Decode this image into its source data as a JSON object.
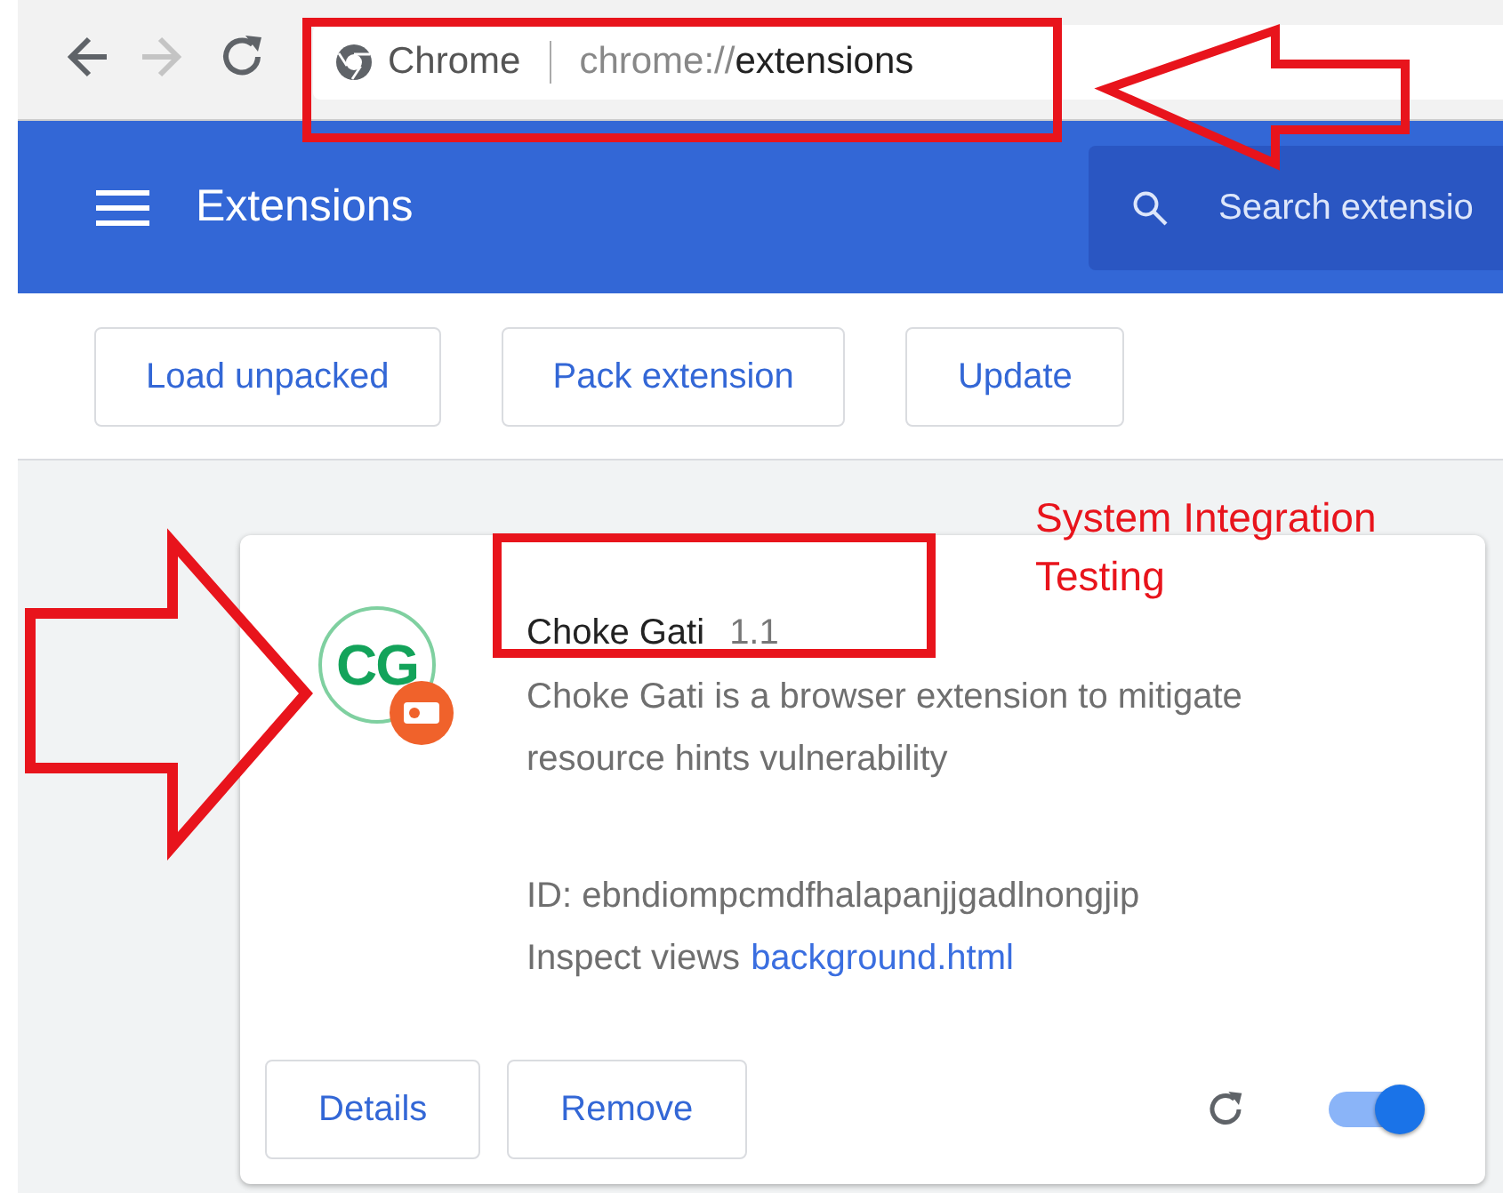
{
  "browser": {
    "nav": [
      {
        "kind": "back",
        "disabled": false
      },
      {
        "kind": "forward",
        "disabled": true
      },
      {
        "kind": "reload",
        "disabled": false
      }
    ],
    "origin_label": "Chrome",
    "url_scheme": "chrome://",
    "url_path": "extensions"
  },
  "header": {
    "title": "Extensions",
    "search": {
      "placeholder": "Search extensio"
    }
  },
  "toolbar_buttons": [
    "Load unpacked",
    "Pack extension",
    "Update"
  ],
  "extension": {
    "icon_text": "CG",
    "name": "Choke Gati",
    "version": "1.1",
    "description": "Choke Gati is a browser extension to mitigate resource hints vulnerability",
    "id_line": "ID: ebndiompcmdfhalapanjjgadlnongjip",
    "inspect_label": "Inspect views",
    "inspect_link": "background.html",
    "buttons": [
      "Details",
      "Remove"
    ],
    "enabled": true
  },
  "annotation": {
    "note": "System Integration Testing"
  }
}
